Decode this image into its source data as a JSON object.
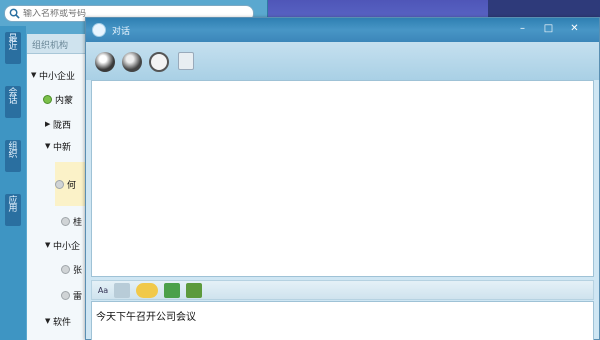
{
  "search": {
    "placeholder": "输入名称或号码"
  },
  "side_tabs": [
    "最近",
    "会话",
    "组织",
    "应用"
  ],
  "contact_panel": {
    "header": "组织机构",
    "tree": [
      {
        "label": "中小企业",
        "type": "group",
        "expanded": true
      },
      {
        "label": "内蒙",
        "type": "contact",
        "status": "online"
      },
      {
        "label": "陇西",
        "type": "group",
        "expanded": false
      },
      {
        "label": "中新",
        "type": "group",
        "expanded": true
      },
      {
        "label": "何",
        "type": "contact",
        "status": "offline",
        "selected": true
      },
      {
        "label": "桂",
        "type": "contact",
        "status": "offline"
      },
      {
        "label": "中小企",
        "type": "group",
        "expanded": true
      },
      {
        "label": "张",
        "type": "contact",
        "status": "offline"
      },
      {
        "label": "雷",
        "type": "contact",
        "status": "offline"
      },
      {
        "label": "软件",
        "type": "group",
        "expanded": true
      }
    ]
  },
  "chat": {
    "title": "对话",
    "toolbar_icons": [
      "file-transfer-icon",
      "screen-capture-icon",
      "history-clock-icon",
      "send-file-icon"
    ],
    "format_icons": [
      "font-icon",
      "text-size-icon",
      "emoji-icon",
      "image-icon",
      "screenshot-icon"
    ],
    "format_font_label": "Aa",
    "input_text": "今天下午召开公司会议"
  },
  "colors": {
    "titlebar": "#3b86b9",
    "panel": "#5aa8cf",
    "online": "#7bc04a"
  }
}
